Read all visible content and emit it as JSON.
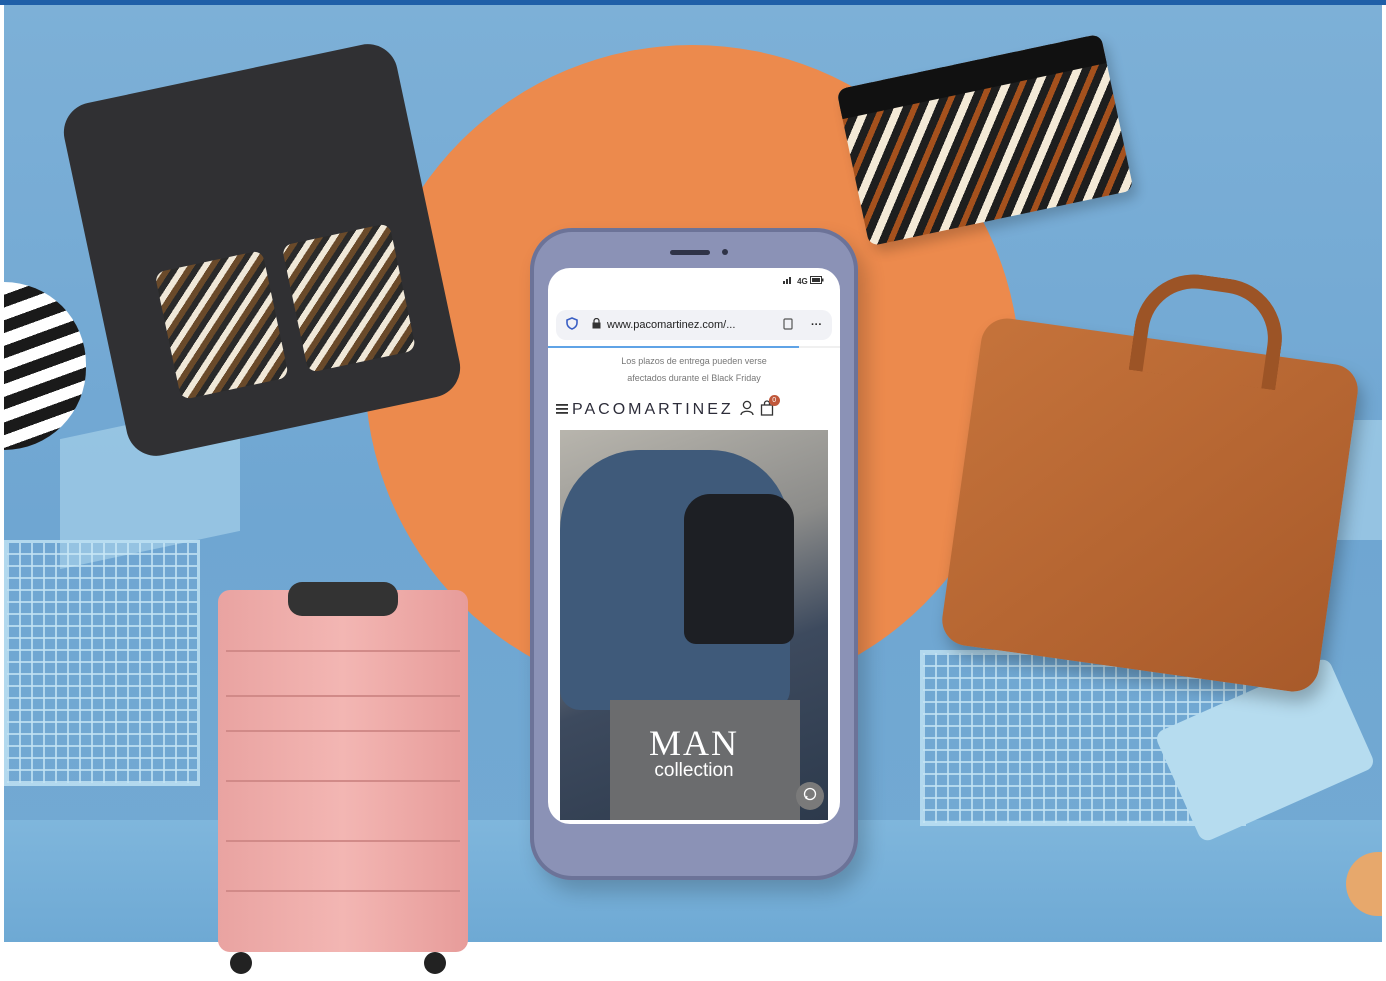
{
  "phone": {
    "status_indicator": "4G",
    "browser": {
      "url": "www.pacomartinez.com/...",
      "menu_dots": "···"
    },
    "notice_line1": "Los plazos de entrega pueden verse",
    "notice_line2": "afectados durante el Black Friday",
    "brand": "PACOMARTINEZ",
    "cart_count": "0",
    "hero_title": "MAN",
    "hero_subtitle": "collection"
  },
  "colors": {
    "background": "#6fa6d2",
    "sun": "#ec8a4d",
    "phone_body": "#8b92b6",
    "suitcase": "#f3b6b3",
    "leather_bag": "#b86630"
  }
}
